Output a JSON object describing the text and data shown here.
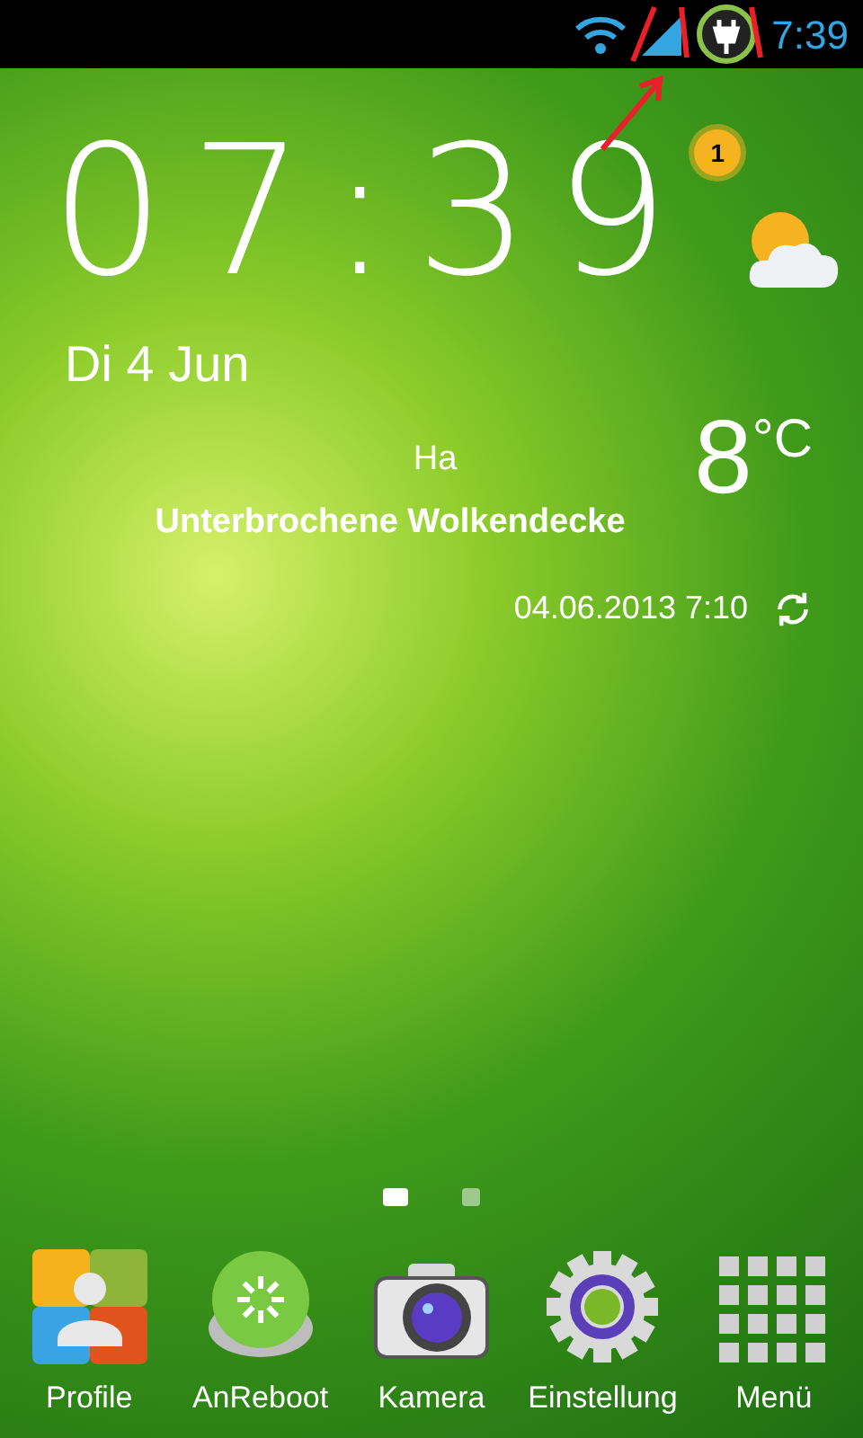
{
  "status_bar": {
    "time": "7:39"
  },
  "clock_widget": {
    "time": "07:39",
    "date": "Di 4 Jun",
    "alert_count": "1"
  },
  "weather": {
    "location": "Ha",
    "condition": "Unterbrochene Wolkendecke",
    "temperature": "8",
    "unit": "°C",
    "updated": "04.06.2013 7:10"
  },
  "page_indicator": [
    {
      "selected": true
    },
    {
      "selected": false
    }
  ],
  "dock": [
    {
      "kind": "profile",
      "label": "Profile"
    },
    {
      "kind": "reboot",
      "label": "AnReboot"
    },
    {
      "kind": "camera",
      "label": "Kamera"
    },
    {
      "kind": "settings",
      "label": "Einstellung"
    },
    {
      "kind": "menu",
      "label": "Menü"
    }
  ]
}
